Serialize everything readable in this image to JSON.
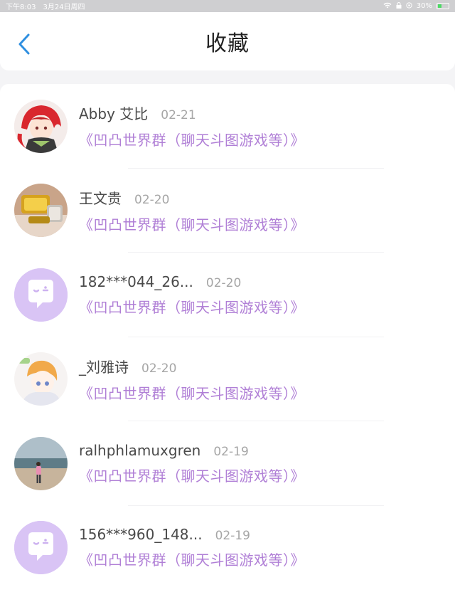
{
  "status": {
    "time": "下午8:03",
    "date": "3月24日周四",
    "battery": "30%"
  },
  "header": {
    "title": "收藏"
  },
  "items": [
    {
      "name": "Abby 艾比",
      "date": "02-21",
      "group": "《凹凸世界群（聊天斗图游戏等）》",
      "avatar": "anime-red-hair"
    },
    {
      "name": "王文贵",
      "date": "02-20",
      "group": "《凹凸世界群（聊天斗图游戏等）》",
      "avatar": "gold-bracelet"
    },
    {
      "name": "182***044_26...",
      "date": "02-20",
      "group": "《凹凸世界群（聊天斗图游戏等）》",
      "avatar": "default-chat"
    },
    {
      "name": "_刘雅诗",
      "date": "02-20",
      "group": "《凹凸世界群（聊天斗图游戏等）》",
      "avatar": "anime-orange-hair"
    },
    {
      "name": "ralhphlamuxgren",
      "date": "02-19",
      "group": "《凹凸世界群（聊天斗图游戏等）》",
      "avatar": "beach-photo"
    },
    {
      "name": "156***960_148...",
      "date": "02-19",
      "group": "《凹凸世界群（聊天斗图游戏等）》",
      "avatar": "default-chat"
    }
  ],
  "colors": {
    "accent": "#2f8fe0",
    "group_text": "#b07fd6",
    "default_avatar_bg": "#d9c4f5"
  }
}
